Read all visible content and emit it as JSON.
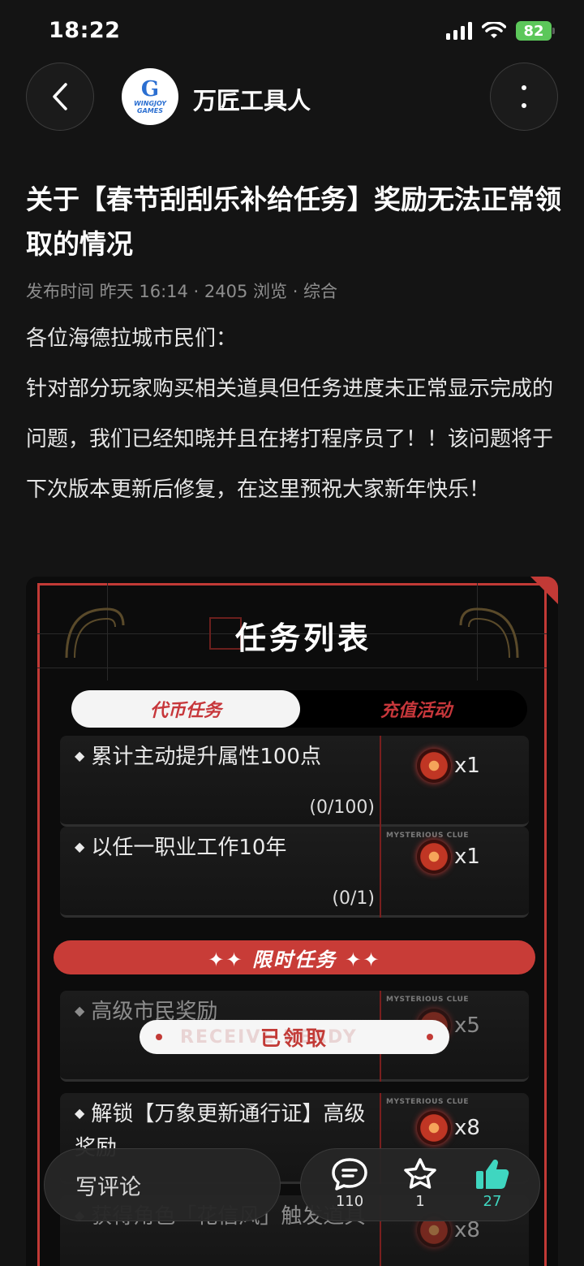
{
  "status_bar": {
    "time": "18:22",
    "battery": "82"
  },
  "nav": {
    "author_name": "万匠工具人",
    "avatar_line1": "WINGJOY",
    "avatar_line2": "GAMES"
  },
  "article": {
    "title": "关于【春节刮刮乐补给任务】奖励无法正常领取的情况",
    "meta": "发布时间 昨天 16:14 · 2405 浏览 · 综合",
    "paragraphs": [
      "各位海德拉城市民们：",
      "针对部分玩家购买相关道具但任务进度未正常显示完成的问题，我们已经知晓并且在拷打程序员了！！该问题将于下次版本更新后修复，在这里预祝大家新年快乐！"
    ]
  },
  "game_image": {
    "title": "任务列表",
    "tabs": [
      "代币任务",
      "充值活动"
    ],
    "active_tab": "代币任务",
    "clue_label": "MYSTERIOUS CLUE",
    "tasks": [
      {
        "name": "累计主动提升属性100点",
        "progress": "(0/100)",
        "reward": "x1"
      },
      {
        "name": "以任一职业工作10年",
        "progress": "(0/1)",
        "reward": "x1"
      }
    ],
    "limited_label": "✦✦ 限时任务 ✦✦",
    "limited_tasks": [
      {
        "name": "高级市民奖励",
        "reward": "x5",
        "status": "已领取",
        "ghost_status": "RECEIVE READY"
      },
      {
        "name": "解锁【万象更新通行证】高级奖励",
        "reward": "x8"
      },
      {
        "name": "获得角色「花信风」触发道具",
        "reward": "x8"
      }
    ]
  },
  "bottom_bar": {
    "comment_placeholder": "写评论",
    "comments_count": "110",
    "favorites_count": "1",
    "likes_count": "27"
  },
  "colors": {
    "accent_red": "#c23a36",
    "like_teal": "#3fd6c0",
    "battery_green": "#5cc75a"
  }
}
